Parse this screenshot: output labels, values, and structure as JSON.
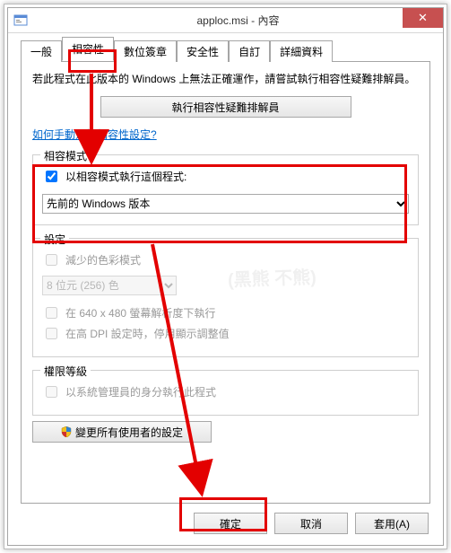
{
  "window": {
    "title": "apploc.msi - 內容",
    "close_label": "✕"
  },
  "tabs": {
    "general": "一般",
    "compat": "相容性",
    "digsig": "數位簽章",
    "security": "安全性",
    "custom": "自訂",
    "details": "詳細資料"
  },
  "hint_text": "若此程式在此版本的 Windows 上無法正確運作，請嘗試執行相容性疑難排解員。",
  "troubleshoot_label": "執行相容性疑難排解員",
  "help_link": "如何手動選擇相容性設定?",
  "group_compat": {
    "title": "相容模式",
    "checkbox_label": "以相容模式執行這個程式:",
    "checkbox_checked": true,
    "select_value": "先前的 Windows 版本"
  },
  "group_settings": {
    "title": "設定",
    "reduced_color_label": "減少的色彩模式",
    "bits_value": "8 位元 (256) 色",
    "res640_label": "在 640 x 480 螢幕解析度下執行",
    "dpi_label": "在高 DPI 設定時，停用顯示調整值"
  },
  "group_priv": {
    "title": "權限等級",
    "admin_label": "以系統管理員的身分執行此程式"
  },
  "allusers_label": "變更所有使用者的設定",
  "buttons": {
    "ok": "確定",
    "cancel": "取消",
    "apply": "套用(A)"
  },
  "watermark": "(黑熊\n不熊)"
}
